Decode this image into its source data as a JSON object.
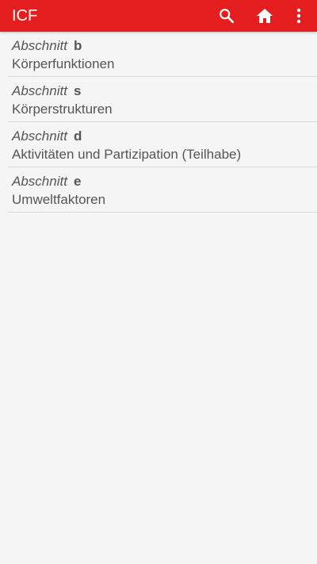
{
  "appbar": {
    "title": "ICF",
    "background_color": "#e41e1e",
    "actions": [
      {
        "icon": "search-icon"
      },
      {
        "icon": "home-icon"
      },
      {
        "icon": "more-vert-icon"
      }
    ]
  },
  "sections": [
    {
      "prefix": "Abschnitt",
      "code": "b",
      "title": "Körperfunktionen"
    },
    {
      "prefix": "Abschnitt",
      "code": "s",
      "title": "Körperstrukturen"
    },
    {
      "prefix": "Abschnitt",
      "code": "d",
      "title": "Aktivitäten und Partizipation (Teilhabe)"
    },
    {
      "prefix": "Abschnitt",
      "code": "e",
      "title": "Umweltfaktoren"
    }
  ]
}
